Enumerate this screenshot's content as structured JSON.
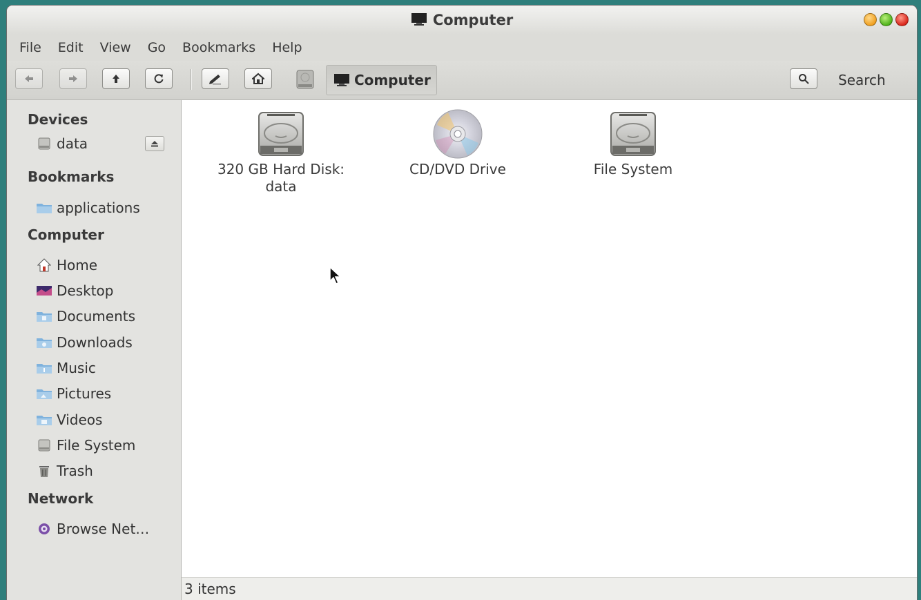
{
  "window": {
    "title": "Computer"
  },
  "menubar": [
    "File",
    "Edit",
    "View",
    "Go",
    "Bookmarks",
    "Help"
  ],
  "toolbar": {
    "back_icon": "arrow-left-icon",
    "forward_icon": "arrow-right-icon",
    "up_icon": "arrow-up-icon",
    "reload_icon": "reload-icon",
    "edit_location_icon": "pencil-icon",
    "home_icon": "home-icon",
    "location_label": "Computer",
    "search_label": "Search"
  },
  "sidebar": {
    "devices": {
      "title": "Devices",
      "items": [
        {
          "label": "data",
          "icon": "drive-icon"
        }
      ]
    },
    "bookmarks": {
      "title": "Bookmarks",
      "items": [
        {
          "label": "applications",
          "icon": "folder-icon"
        }
      ]
    },
    "computer": {
      "title": "Computer",
      "items": [
        {
          "label": "Home",
          "icon": "home-icon"
        },
        {
          "label": "Desktop",
          "icon": "desktop-icon"
        },
        {
          "label": "Documents",
          "icon": "documents-folder-icon"
        },
        {
          "label": "Downloads",
          "icon": "downloads-folder-icon"
        },
        {
          "label": "Music",
          "icon": "music-folder-icon"
        },
        {
          "label": "Pictures",
          "icon": "pictures-folder-icon"
        },
        {
          "label": "Videos",
          "icon": "videos-folder-icon"
        },
        {
          "label": "File System",
          "icon": "drive-icon"
        },
        {
          "label": "Trash",
          "icon": "trash-icon"
        }
      ]
    },
    "network": {
      "title": "Network",
      "items": [
        {
          "label": "Browse Net…",
          "icon": "network-icon"
        }
      ]
    }
  },
  "content": {
    "items": [
      {
        "label_line1": "320 GB Hard Disk:",
        "label_line2": "data",
        "icon": "hard-disk-icon"
      },
      {
        "label_line1": "CD/DVD Drive",
        "icon": "optical-disc-icon"
      },
      {
        "label_line1": "File System",
        "icon": "hard-disk-icon"
      }
    ]
  },
  "statusbar": {
    "text": "3 items"
  },
  "colors": {
    "desktop": "#2f7f7c",
    "window_bg": "#efefec",
    "content_bg": "#ffffff",
    "close": "#d9251a",
    "maximize": "#4fb21b",
    "minimize": "#f0a020"
  }
}
